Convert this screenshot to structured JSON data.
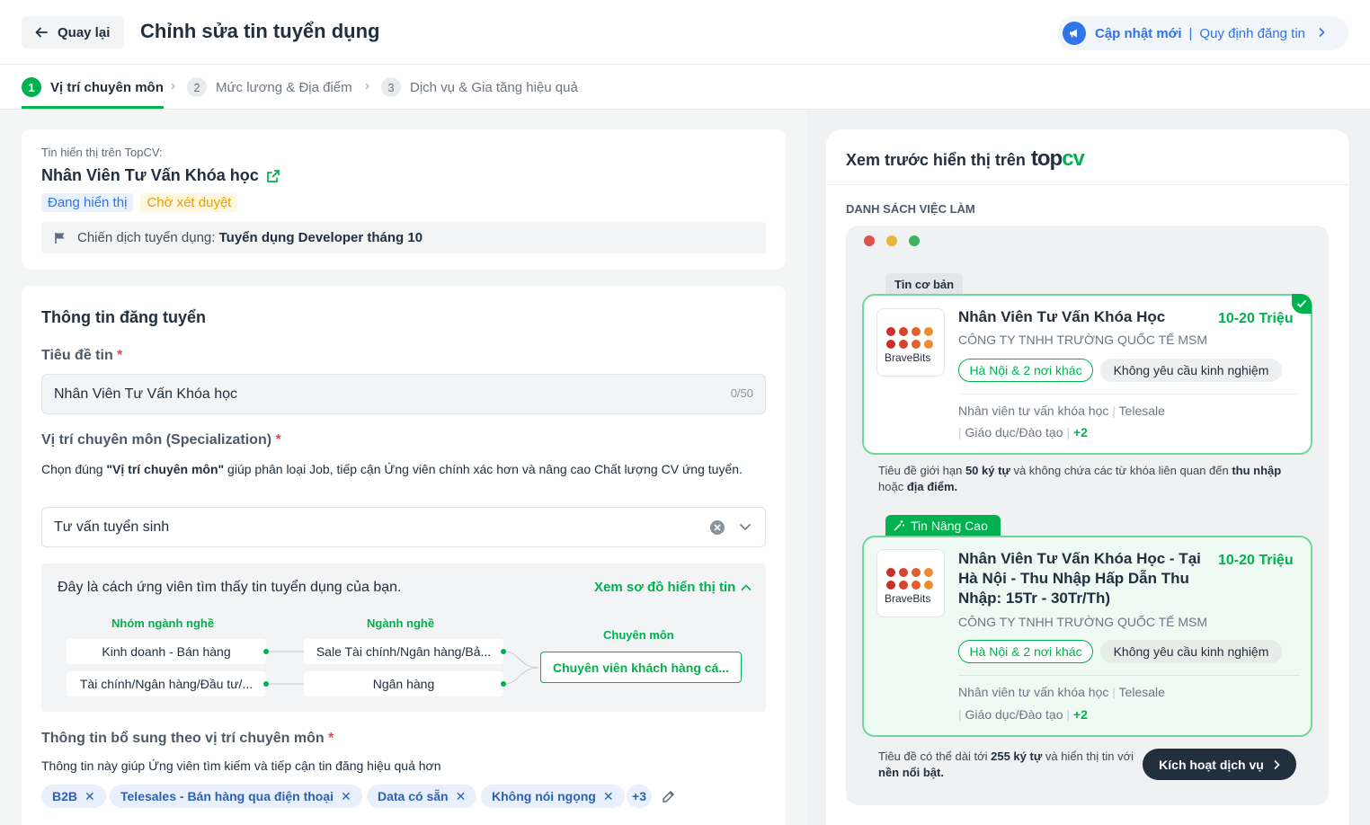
{
  "header": {
    "back_label": "Quay lại",
    "title": "Chỉnh sửa tin tuyển dụng",
    "update_label": "Cập nhật mới",
    "rules_label": "Quy định đăng tin"
  },
  "steps": [
    {
      "num": "1",
      "label": "Vị trí chuyên môn"
    },
    {
      "num": "2",
      "label": "Mức lương & Địa điểm"
    },
    {
      "num": "3",
      "label": "Dịch vụ & Gia tăng hiệu quả"
    }
  ],
  "post_info": {
    "shown_on": "Tin hiển thị trên TopCV:",
    "job_name": "Nhân Viên Tư Vấn Khóa học",
    "status_active": "Đang hiển thị",
    "status_pending": "Chờ xét duyệt",
    "campaign_label": "Chiến dịch tuyển dụng:",
    "campaign_value": "Tuyển dụng Developer tháng 10"
  },
  "form": {
    "section_title": "Thông tin đăng tuyển",
    "title_label": "Tiêu đề tin",
    "required_mark": "*",
    "title_value": "Nhân Viên Tư Vấn Khóa học",
    "title_counter": "0/50",
    "spec_label": "Vị trí chuyên môn (Specialization)",
    "spec_help_prefix": "Chọn đúng ",
    "spec_help_bold": "\"Vị trí chuyên môn\"",
    "spec_help_suffix": " giúp phân loại Job, tiếp cận Ứng viên chính xác hơn và nâng cao Chất lượng CV ứng tuyển.",
    "spec_value": "Tư vấn tuyển sinh",
    "map_intro": "Đây là cách ứng viên tìm thấy tin tuyển dụng của bạn.",
    "map_toggle": "Xem sơ đồ hiển thị tin",
    "map": {
      "col1_title": "Nhóm ngành nghề",
      "col2_title": "Ngành nghề",
      "col3_title": "Chuyên môn",
      "col1": [
        "Kinh doanh - Bán hàng",
        "Tài chính/Ngân hàng/Đầu tư/..."
      ],
      "col2": [
        "Sale Tài chính/Ngân hàng/Bả...",
        "Ngân hàng"
      ],
      "col3": "Chuyên viên khách hàng cá..."
    },
    "extra_label": "Thông tin bổ sung theo vị trí chuyên môn",
    "extra_help": "Thông tin này giúp Ứng viên tìm kiếm và tiếp cận tin đăng hiệu quả hơn",
    "chips": [
      "B2B",
      "Telesales - Bán hàng qua điện thoại",
      "Data có sẵn",
      "Không nói ngọng"
    ],
    "chips_more": "+3"
  },
  "preview": {
    "title": "Xem trước hiển thị trên",
    "brand": "topcv",
    "list_label": "DANH SÁCH VIỆC LÀM",
    "basic_tab": "Tin cơ bản",
    "advanced_tab": "Tin Nâng Cao",
    "logo_text": "BraveBits",
    "basic": {
      "title": "Nhân Viên Tư Vấn Khóa Học",
      "salary": "10-20 Triệu",
      "company": "CÔNG TY TNHH TRƯỜNG QUỐC TẾ MSM",
      "location": "Hà Nội & 2 nơi khác",
      "experience": "Không yêu cầu kinh nghiệm",
      "kw1": "Nhân viên tư vấn khóa học",
      "kw2": "Telesale",
      "kw3": "Giáo dục/Đào tạo",
      "kw_more": "+2"
    },
    "basic_note": {
      "a": "Tiêu đề giới hạn ",
      "b": "50 ký tự",
      "c": " và không chứa các từ khóa liên quan đến ",
      "d": "thu nhập",
      "e": " hoặc ",
      "f": "địa điểm."
    },
    "advanced": {
      "title": "Nhân Viên Tư Vấn Khóa Học - Tại Hà Nội - Thu Nhập Hấp Dẫn Thu Nhập: 15Tr - 30Tr/Th)",
      "salary": "10-20 Triệu",
      "company": "CÔNG TY TNHH TRƯỜNG QUỐC TẾ MSM",
      "location": "Hà Nội & 2 nơi khác",
      "experience": "Không yêu cầu kinh nghiệm",
      "kw1": "Nhân viên tư vấn khóa học",
      "kw2": "Telesale",
      "kw3": "Giáo dục/Đào tạo",
      "kw_more": "+2"
    },
    "advanced_note": {
      "a": "Tiêu đề có thể dài tới ",
      "b": "255 ký tự",
      "c": " và hiển thị tin với ",
      "d": "nền nổi bật."
    },
    "cta": "Kích hoạt dịch vụ"
  },
  "colors": {
    "accent_green": "#00b14f",
    "accent_blue": "#2f74e9",
    "dark": "#212f3f"
  }
}
